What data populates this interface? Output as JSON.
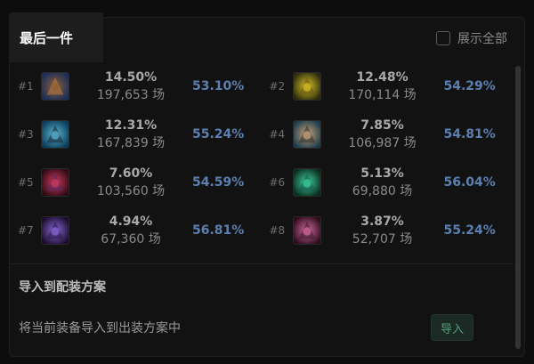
{
  "tab": {
    "active_label": "最后一件"
  },
  "show_all": {
    "label": "展示全部"
  },
  "items": [
    {
      "rank": "#1",
      "pick_rate": "14.50%",
      "games": "197,653 场",
      "win_rate": "53.10%",
      "icon": "spiked-helm-icon",
      "colors": [
        "#1b2d59",
        "#8a5f3a",
        "#c47c3c"
      ]
    },
    {
      "rank": "#2",
      "pick_rate": "12.48%",
      "games": "170,114 场",
      "win_rate": "54.29%",
      "icon": "gold-triangle-icon",
      "colors": [
        "#2b2a0c",
        "#d8c22a",
        "#6a5a12"
      ]
    },
    {
      "rank": "#3",
      "pick_rate": "12.31%",
      "games": "167,839 场",
      "win_rate": "55.24%",
      "icon": "blue-blade-icon",
      "colors": [
        "#0b3b57",
        "#5ab8d4",
        "#1a2030"
      ]
    },
    {
      "rank": "#4",
      "pick_rate": "7.85%",
      "games": "106,987 场",
      "win_rate": "54.81%",
      "icon": "stone-armor-icon",
      "colors": [
        "#1b3b4b",
        "#caa47a",
        "#2e2a2a"
      ]
    },
    {
      "rank": "#5",
      "pick_rate": "7.60%",
      "games": "103,560 场",
      "win_rate": "54.59%",
      "icon": "red-claw-icon",
      "colors": [
        "#2b0a14",
        "#d03a5a",
        "#5a2a6a"
      ]
    },
    {
      "rank": "#6",
      "pick_rate": "5.13%",
      "games": "69,880 场",
      "win_rate": "56.04%",
      "icon": "green-wing-icon",
      "colors": [
        "#0b2b1b",
        "#3ad0a0",
        "#1a5a4a"
      ]
    },
    {
      "rank": "#7",
      "pick_rate": "4.94%",
      "games": "67,360 场",
      "win_rate": "56.81%",
      "icon": "purple-scythe-icon",
      "colors": [
        "#1a0b2b",
        "#8a6ad8",
        "#2a1a4a"
      ]
    },
    {
      "rank": "#8",
      "pick_rate": "3.87%",
      "games": "52,707 场",
      "win_rate": "55.24%",
      "icon": "pink-crescent-icon",
      "colors": [
        "#2a0b1a",
        "#d46aa0",
        "#3a1a2a"
      ]
    }
  ],
  "import": {
    "title": "导入到配装方案",
    "description": "将当前装备导入到出装方案中",
    "button_label": "导入"
  }
}
